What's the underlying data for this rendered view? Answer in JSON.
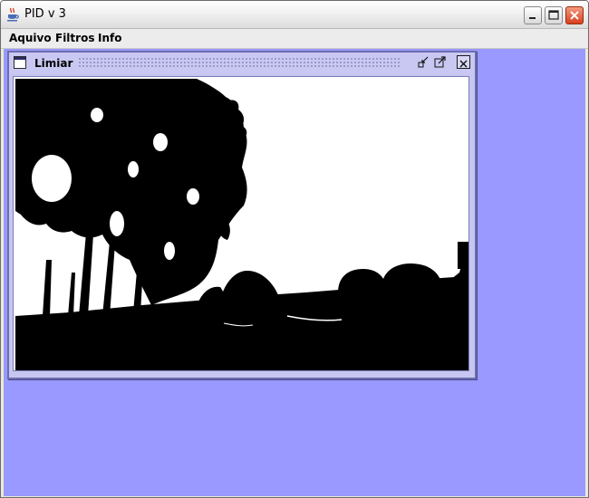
{
  "window": {
    "title": "PID v 3",
    "icons": {
      "app": "java-cup-icon",
      "minimize": "minimize-icon",
      "maximize": "maximize-icon",
      "close": "close-icon"
    }
  },
  "menubar": {
    "items": [
      "Aquivo",
      "Filtros",
      "Info"
    ]
  },
  "internal_frame": {
    "title": "Limiar",
    "icons": {
      "frame": "window-icon",
      "minimize": "restore-down-icon",
      "maximize": "maximize-icon",
      "close": "close-icon"
    }
  },
  "colors": {
    "desktop": "#9999ff",
    "internal_frame": "#c6c6f0",
    "title_close": "#d6401d"
  }
}
